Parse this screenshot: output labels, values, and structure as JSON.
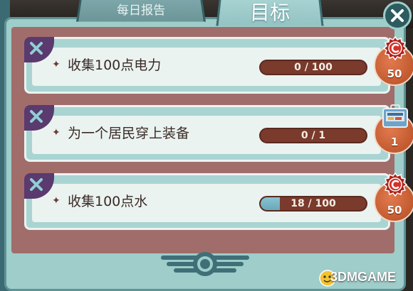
{
  "tabs": {
    "daily_report": "每日报告",
    "goals": "目标"
  },
  "objectives": [
    {
      "label": "收集100点电力",
      "progress_text": "0 / 100",
      "progress": 0.0,
      "reward_type": "caps",
      "reward_amount": "50",
      "reward_icon": "caps-icon"
    },
    {
      "label": "为一个居民穿上装备",
      "progress_text": "0 / 1",
      "progress": 0.0,
      "reward_type": "lunchbox",
      "reward_amount": "1",
      "reward_icon": "lunchbox-icon"
    },
    {
      "label": "收集100点水",
      "progress_text": "18 / 100",
      "progress": 0.18,
      "reward_type": "caps",
      "reward_amount": "50",
      "reward_icon": "caps-icon"
    }
  ],
  "bullet_glyph": "✦",
  "watermark": "3DMGAME",
  "colors": {
    "panel": "#9ecdca",
    "inner": "#a06d6a",
    "card": "#eaf3f0",
    "progress_track": "#7a3a2c",
    "progress_fill": "#6aa9ba",
    "reward": "#c35a2f",
    "close": "#2d5b60"
  }
}
